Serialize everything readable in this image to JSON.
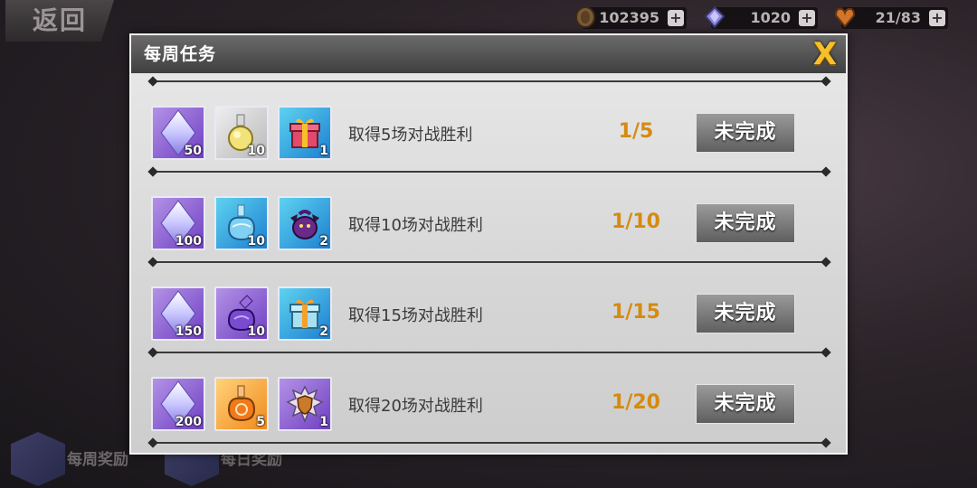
{
  "top_bar": {
    "back_label": "返回",
    "resources": [
      {
        "name": "coin",
        "value": "102395",
        "icon": "coin-icon"
      },
      {
        "name": "gem",
        "value": "1020",
        "icon": "gem-icon"
      },
      {
        "name": "stamina",
        "value": "21/83",
        "icon": "heart-icon"
      }
    ]
  },
  "bottom_tabs": [
    {
      "label": "每周奖励",
      "icon": "chest-icon"
    },
    {
      "label": "每日奖励",
      "icon": "chest-icon"
    }
  ],
  "dialog": {
    "title": "每周任务",
    "close_label": "X",
    "tasks": [
      {
        "text": "取得5场对战胜利",
        "progress": "1/5",
        "status": "未完成",
        "rewards": [
          {
            "icon": "crystal-icon",
            "count": "50",
            "rarity": "purple"
          },
          {
            "icon": "potion-flask-icon",
            "count": "10",
            "rarity": "white"
          },
          {
            "icon": "gift-box-icon",
            "count": "1",
            "rarity": "blue"
          }
        ]
      },
      {
        "text": "取得10场对战胜利",
        "progress": "1/10",
        "status": "未完成",
        "rewards": [
          {
            "icon": "crystal-icon",
            "count": "100",
            "rarity": "purple"
          },
          {
            "icon": "blue-potion-icon",
            "count": "10",
            "rarity": "blue"
          },
          {
            "icon": "dark-pouch-icon",
            "count": "2",
            "rarity": "blue"
          }
        ]
      },
      {
        "text": "取得15场对战胜利",
        "progress": "1/15",
        "status": "未完成",
        "rewards": [
          {
            "icon": "crystal-icon",
            "count": "150",
            "rarity": "purple"
          },
          {
            "icon": "purple-potion-icon",
            "count": "10",
            "rarity": "purple"
          },
          {
            "icon": "gift-box-icon",
            "count": "2",
            "rarity": "blue"
          }
        ]
      },
      {
        "text": "取得20场对战胜利",
        "progress": "1/20",
        "status": "未完成",
        "rewards": [
          {
            "icon": "crystal-icon",
            "count": "200",
            "rarity": "purple"
          },
          {
            "icon": "orange-potion-icon",
            "count": "5",
            "rarity": "orange"
          },
          {
            "icon": "shield-emblem-icon",
            "count": "1",
            "rarity": "purple"
          }
        ]
      }
    ]
  }
}
